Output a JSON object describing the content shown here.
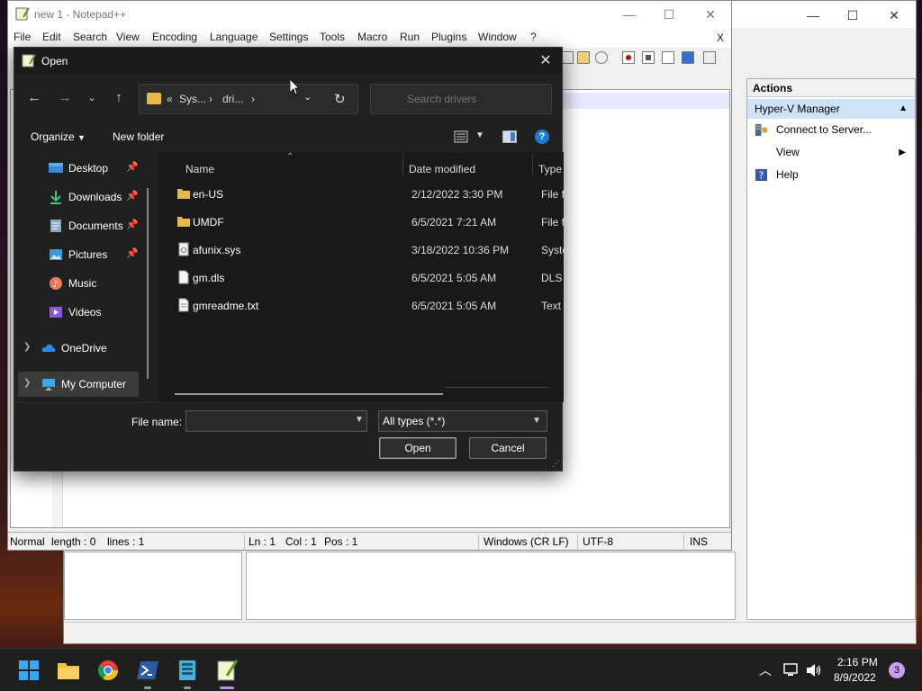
{
  "hyperv": {
    "actions_header": "Actions",
    "section": "Hyper-V Manager",
    "items": [
      {
        "label": "Connect to Server...",
        "icon": "server-connect-icon"
      },
      {
        "label": "View",
        "icon": "",
        "submenu": true
      },
      {
        "label": "Help",
        "icon": "help-icon"
      }
    ]
  },
  "notepad": {
    "title": "new 1 - Notepad++",
    "menu": [
      "File",
      "Edit",
      "Search",
      "View",
      "Encoding",
      "Language",
      "Settings",
      "Tools",
      "Macro",
      "Run",
      "Plugins",
      "Window",
      "?"
    ],
    "close_doc": "X",
    "status": {
      "mode": "Normal",
      "length": "length : 0",
      "lines": "lines : 1",
      "ln": "Ln : 1",
      "col": "Col : 1",
      "pos": "Pos : 1",
      "eol": "Windows (CR LF)",
      "encoding": "UTF-8",
      "ins": "INS"
    }
  },
  "dialog": {
    "title": "Open",
    "address": {
      "prefix": "«",
      "parts": [
        "Sys...",
        "dri..."
      ]
    },
    "search_placeholder": "Search drivers",
    "organize": "Organize",
    "new_folder": "New folder",
    "nav": [
      {
        "label": "Desktop",
        "icon": "desktop-icon",
        "pinned": true
      },
      {
        "label": "Downloads",
        "icon": "download-icon",
        "pinned": true
      },
      {
        "label": "Documents",
        "icon": "documents-icon",
        "pinned": true
      },
      {
        "label": "Pictures",
        "icon": "pictures-icon",
        "pinned": true
      },
      {
        "label": "Music",
        "icon": "music-icon",
        "pinned": false
      },
      {
        "label": "Videos",
        "icon": "videos-icon",
        "pinned": false
      }
    ],
    "onedrive": "OneDrive",
    "mycomputer": "My Computer",
    "columns": {
      "name": "Name",
      "date": "Date modified",
      "type": "Type"
    },
    "files": [
      {
        "name": "en-US",
        "date": "2/12/2022 3:30 PM",
        "type": "File folder",
        "kind": "folder"
      },
      {
        "name": "UMDF",
        "date": "6/5/2021 7:21 AM",
        "type": "File folder",
        "kind": "folder"
      },
      {
        "name": "afunix.sys",
        "date": "3/18/2022 10:36 PM",
        "type": "System file",
        "kind": "sys"
      },
      {
        "name": "gm.dls",
        "date": "6/5/2021 5:05 AM",
        "type": "DLS File",
        "kind": "file"
      },
      {
        "name": "gmreadme.txt",
        "date": "6/5/2021 5:05 AM",
        "type": "Text Document",
        "kind": "txt"
      }
    ],
    "file_name_label": "File name:",
    "file_name_value": "",
    "file_type": "All types (*.*)",
    "open_btn": "Open",
    "cancel_btn": "Cancel"
  },
  "taskbar": {
    "time": "2:16 PM",
    "date": "8/9/2022",
    "notifications": "3"
  },
  "colors": {
    "folder": "#e8b84a",
    "accent": "#1e7bd6",
    "selection": "#cfe3f8"
  }
}
